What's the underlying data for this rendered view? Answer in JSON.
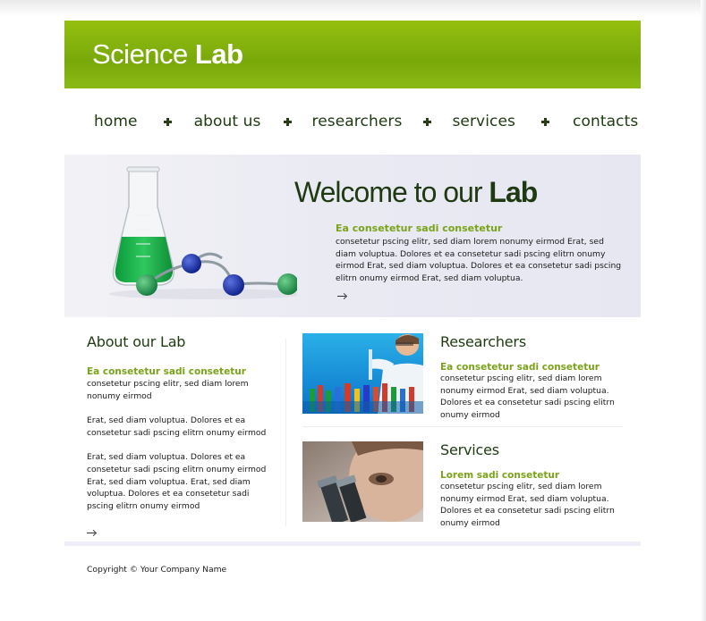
{
  "brand": {
    "logo_light": "Science",
    "logo_bold": "Lab"
  },
  "nav": {
    "items": [
      {
        "label": "home"
      },
      {
        "label": "about us"
      },
      {
        "label": "researchers"
      },
      {
        "label": "services"
      },
      {
        "label": "contacts"
      }
    ]
  },
  "hero": {
    "title_light": "Welcome to our ",
    "title_bold": "Lab",
    "subtitle": "Ea consetetur sadi consetetur",
    "text": "consetetur pscing elitr, sed diam lorem nonumy eirmod Erat, sed diam voluptua. Dolores et ea consetetur sadi pscing elitrn onumy eirmod Erat, sed diam voluptua. Dolores et ea consetetur sadi pscing elitrn onumy eirmod Erat, sed diam voluptua."
  },
  "about": {
    "title": "About our Lab",
    "subtitle": "Ea consetetur sadi consetetur",
    "p1": "consetetur pscing elitr, sed diam lorem nonumy eirmod",
    "p2": "Erat, sed diam voluptua. Dolores et ea consetetur sadi pscing elitrn onumy eirmod",
    "p3": "Erat, sed diam voluptua. Dolores et ea consetetur sadi pscing elitrn onumy eirmod Erat, sed diam voluptua. Erat, sed diam voluptua. Dolores et ea consetetur sadi pscing elitrn onumy eirmod"
  },
  "researchers": {
    "title": "Researchers",
    "subtitle": "Ea consetetur sadi consetetur",
    "text": "consetetur pscing elitr, sed diam lorem nonumy eirmod Erat, sed diam voluptua. Dolores et ea consetetur sadi pscing elitrn onumy eirmod"
  },
  "services": {
    "title": "Services",
    "subtitle": "Lorem sadi consetetur",
    "text": "consetetur pscing elitr, sed diam lorem nonumy eirmod Erat, sed diam voluptua. Dolores et ea consetetur sadi pscing elitrn onumy eirmod"
  },
  "footer": {
    "copyright": "Copyright © Your Company Name"
  },
  "colors": {
    "header_green": "#86b40e",
    "accent_green": "#7aa21a",
    "heading_dark": "#1f3a12",
    "hero_bg": "#eaeaf3"
  },
  "icons": [
    "arrow-right-icon",
    "nav-separator-icon"
  ]
}
